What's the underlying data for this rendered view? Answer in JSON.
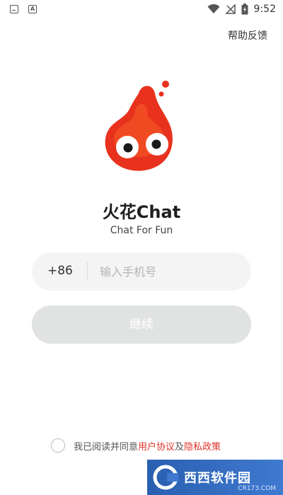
{
  "status_bar": {
    "time": "9:52",
    "icons": [
      "download-icon",
      "a-text-icon",
      "wifi-icon",
      "signal-off-icon",
      "battery-charging-icon"
    ]
  },
  "header": {
    "help_feedback": "帮助反馈"
  },
  "app": {
    "title": "火花Chat",
    "subtitle": "Chat For Fun"
  },
  "login": {
    "country_code": "+86",
    "phone_placeholder": "输入手机号",
    "phone_value": "",
    "continue_label": "继续"
  },
  "agreement": {
    "prefix": "我已阅读并同意",
    "user_agreement": "用户协议",
    "and": "及",
    "privacy_policy": "隐私政策",
    "checked": false
  },
  "watermark": {
    "text": "西西软件园",
    "sub": "CR173.COM"
  },
  "colors": {
    "accent": "#e0342a",
    "logo_red": "#e8321e",
    "button_disabled": "#e1e3e3",
    "input_bg": "#f4f4f4"
  }
}
